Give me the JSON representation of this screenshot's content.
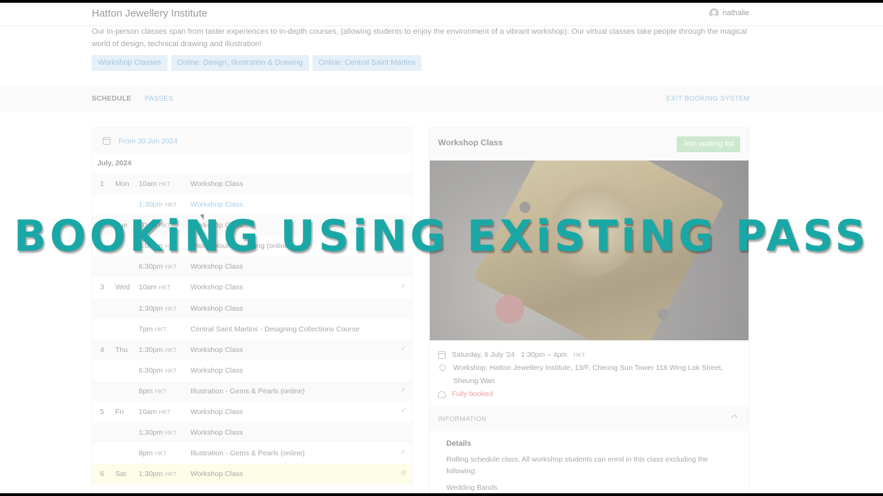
{
  "header": {
    "brand": "Hatton Jewellery Institute",
    "user": "nathalie"
  },
  "intro": "Our in-person classes span from taster experiences to in-depth courses, (allowing students to enjoy the environment of a vibrant workshop). Our virtual classes take people through the magical world of design, technical drawing and illustration!",
  "categories": [
    "Workshop Classes",
    "Online: Design, Illustration & Drawing",
    "Online: Central Saint Martins"
  ],
  "nav": {
    "schedule": "SCHEDULE",
    "passes": "PASSES",
    "exit": "EXIT BOOKING SYSTEM"
  },
  "schedule": {
    "from": "From 30 Jun 2024",
    "month": "July, 2024",
    "tz": "HKT",
    "rows": [
      {
        "day": "1",
        "dow": "Mon",
        "time": "10am",
        "cls": "Workshop Class",
        "status": ""
      },
      {
        "day": "",
        "dow": "",
        "time": "1:30pm",
        "cls": "Workshop Class",
        "status": ""
      },
      {
        "day": "2",
        "dow": "Tue",
        "time": "10am",
        "cls": "Workshop Class",
        "status": ""
      },
      {
        "day": "",
        "dow": "",
        "time": "4:00pm",
        "cls": "Watercolour Rendering (online)",
        "status": ""
      },
      {
        "day": "",
        "dow": "",
        "time": "6:30pm",
        "cls": "Workshop Class",
        "status": ""
      },
      {
        "day": "3",
        "dow": "Wed",
        "time": "10am",
        "cls": "Workshop Class",
        "status": "✓"
      },
      {
        "day": "",
        "dow": "",
        "time": "1:30pm",
        "cls": "Workshop Class",
        "status": ""
      },
      {
        "day": "",
        "dow": "",
        "time": "7pm",
        "cls": "Central Saint Martins - Designing Collections Course",
        "status": ""
      },
      {
        "day": "4",
        "dow": "Thu",
        "time": "1:30pm",
        "cls": "Workshop Class",
        "status": "✓"
      },
      {
        "day": "",
        "dow": "",
        "time": "6:30pm",
        "cls": "Workshop Class",
        "status": ""
      },
      {
        "day": "",
        "dow": "",
        "time": "8pm",
        "cls": "Illustration - Gems & Pearls (online)",
        "status": "✓"
      },
      {
        "day": "5",
        "dow": "Fri",
        "time": "10am",
        "cls": "Workshop Class",
        "status": "✓"
      },
      {
        "day": "",
        "dow": "",
        "time": "1:30pm",
        "cls": "Workshop Class",
        "status": ""
      },
      {
        "day": "",
        "dow": "",
        "time": "8pm",
        "cls": "Illustration - Gems & Pearls (online)",
        "status": "✓"
      },
      {
        "day": "6",
        "dow": "Sat",
        "time": "1:30pm",
        "cls": "Workshop Class",
        "status": "⊘"
      }
    ]
  },
  "detail": {
    "title": "Workshop Class",
    "wait_button": "Join waiting list",
    "date": "Saturday, 6 July '24",
    "time": "1:30pm – 4pm",
    "tz": "HKT",
    "location": "Workshop: Hatton Jewellery Institute, 13/F, Cheong Sun Tower 118 Wing Lok Street, Sheung Wan",
    "capacity": "Fully booked",
    "info_header": "INFORMATION",
    "details_title": "Details",
    "details_text": "Rolling schedule class. All workshop students can enrol in this class excluding the following:",
    "details_item": "Wedding Bands"
  },
  "overlay": "BOOKiNG USiNG EXiSTiNG PASS",
  "colors": {
    "overlay": "#1aa8a6",
    "link": "#a8cce8",
    "full": "#f0a0a6",
    "highlight": "#fdfde8"
  }
}
